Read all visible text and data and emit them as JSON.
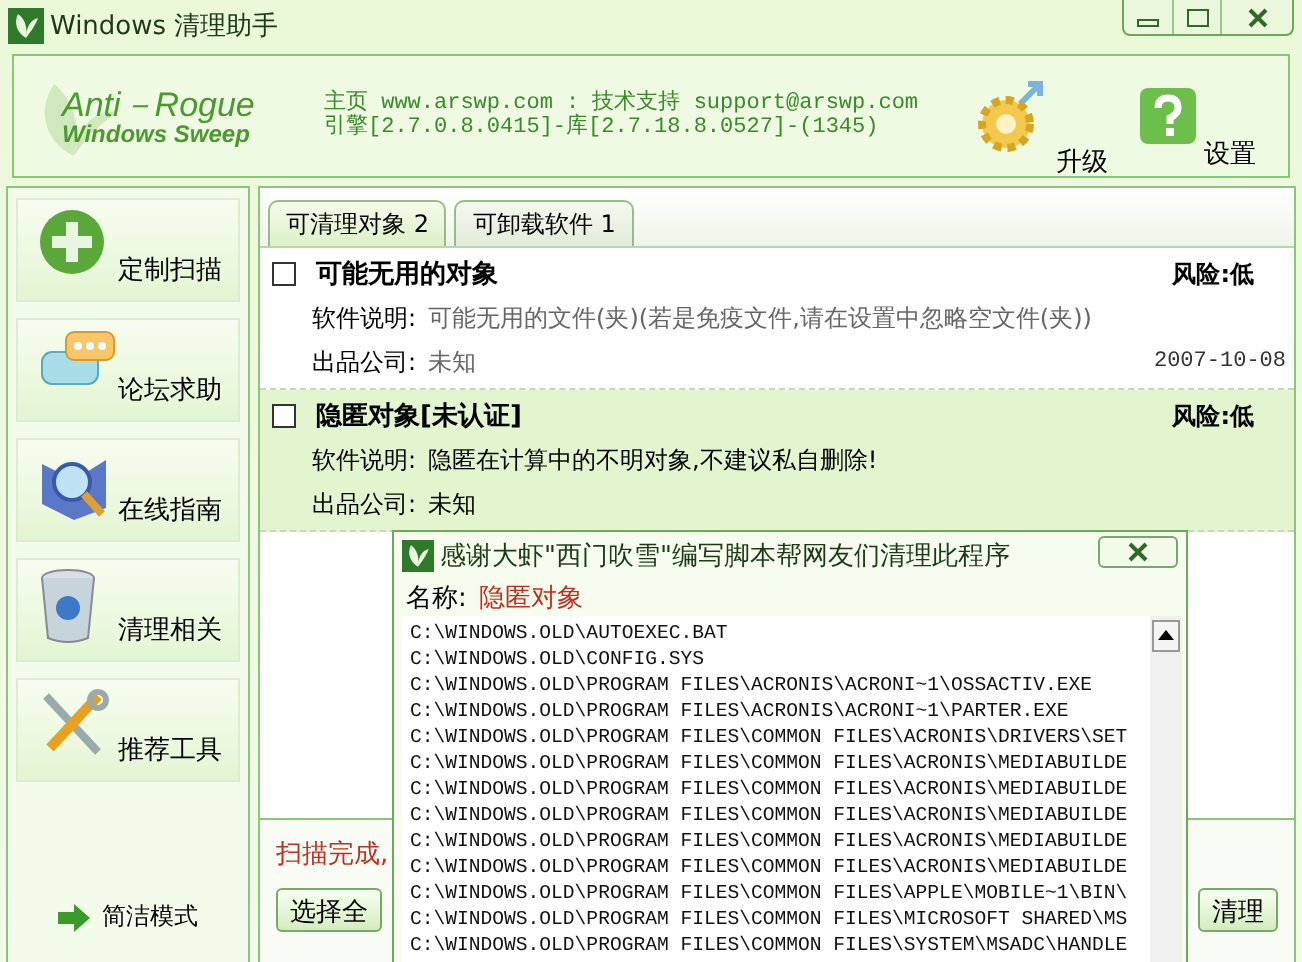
{
  "window": {
    "title": "Windows 清理助手"
  },
  "banner": {
    "logo_line1": "Anti－Rogue",
    "logo_line2": "Windows Sweep",
    "info_line1": "主页 www.arswp.com : 技术支持 support@arswp.com",
    "info_line2": "引擎[2.7.0.8.0415]-库[2.7.18.8.0527]-(1345)",
    "actions": [
      {
        "label": "升级",
        "kind": "gear"
      },
      {
        "label": "设置",
        "kind": "help"
      }
    ]
  },
  "sidebar": {
    "items": [
      {
        "label": "定制扫描",
        "kind": "plus"
      },
      {
        "label": "论坛求助",
        "kind": "chat"
      },
      {
        "label": "在线指南",
        "kind": "guide"
      },
      {
        "label": "清理相关",
        "kind": "bin"
      },
      {
        "label": "推荐工具",
        "kind": "tools"
      }
    ],
    "mode_link": "简洁模式"
  },
  "tabs": [
    {
      "label": "可清理对象 2",
      "selected": true
    },
    {
      "label": "可卸载软件 1",
      "selected": false
    }
  ],
  "items": [
    {
      "name": "可能无用的对象",
      "risk": "风险:低",
      "desc_label": "软件说明:",
      "desc": "可能无用的文件(夹)(若是免疫文件,请在设置中忽略空文件(夹))",
      "company_label": "出品公司:",
      "company": "未知",
      "date": "2007-10-08",
      "checked": false,
      "selected": false
    },
    {
      "name": "隐匿对象[未认证]",
      "risk": "风险:低",
      "desc_label": "软件说明:",
      "desc": "隐匿在计算中的不明对象,不建议私自删除!",
      "company_label": "出品公司:",
      "company": "未知",
      "checked": false,
      "selected": true
    }
  ],
  "status": "扫描完成,",
  "buttons": [
    "选择全",
    "清理"
  ],
  "popup": {
    "title": "感谢大虾\"西门吹雪\"编写脚本帮网友们清理此程序",
    "name_label": "名称:",
    "name_value": "隐匿对象",
    "files": [
      "C:\\WINDOWS.OLD\\AUTOEXEC.BAT",
      "C:\\WINDOWS.OLD\\CONFIG.SYS",
      "C:\\WINDOWS.OLD\\PROGRAM FILES\\ACRONIS\\ACRONI~1\\OSSACTIV.EXE",
      "C:\\WINDOWS.OLD\\PROGRAM FILES\\ACRONIS\\ACRONI~1\\PARTER.EXE",
      "C:\\WINDOWS.OLD\\PROGRAM FILES\\COMMON FILES\\ACRONIS\\DRIVERS\\SET",
      "C:\\WINDOWS.OLD\\PROGRAM FILES\\COMMON FILES\\ACRONIS\\MEDIABUILDE",
      "C:\\WINDOWS.OLD\\PROGRAM FILES\\COMMON FILES\\ACRONIS\\MEDIABUILDE",
      "C:\\WINDOWS.OLD\\PROGRAM FILES\\COMMON FILES\\ACRONIS\\MEDIABUILDE",
      "C:\\WINDOWS.OLD\\PROGRAM FILES\\COMMON FILES\\ACRONIS\\MEDIABUILDE",
      "C:\\WINDOWS.OLD\\PROGRAM FILES\\COMMON FILES\\ACRONIS\\MEDIABUILDE",
      "C:\\WINDOWS.OLD\\PROGRAM FILES\\COMMON FILES\\APPLE\\MOBILE~1\\BIN\\",
      "C:\\WINDOWS.OLD\\PROGRAM FILES\\COMMON FILES\\MICROSOFT SHARED\\MS",
      "C:\\WINDOWS.OLD\\PROGRAM FILES\\COMMON FILES\\SYSTEM\\MSADC\\HANDLE"
    ]
  }
}
